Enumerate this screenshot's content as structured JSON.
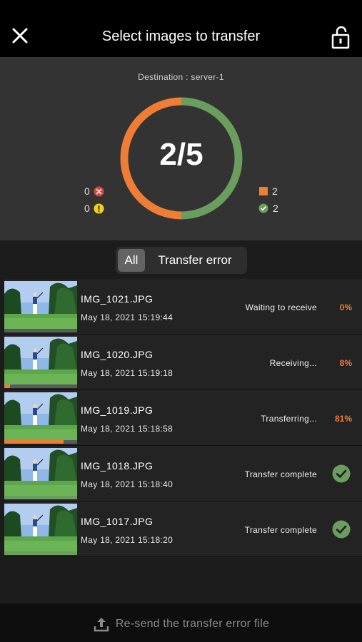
{
  "header": {
    "title": "Select images to transfer",
    "close_icon": "close-icon",
    "lock_icon": "unlock-icon"
  },
  "summary": {
    "destination": "Destination : server-1",
    "count_text": "2/5",
    "progress": {
      "pending_fraction": 0.5,
      "complete_fraction": 0.5
    },
    "left_stats": {
      "error_count": "0",
      "warning_count": "0"
    },
    "right_stats": {
      "in_progress_count": "2",
      "complete_count": "2"
    },
    "colors": {
      "pending": "#ef7d36",
      "complete": "#6a9d5e",
      "track": "#262626",
      "error": "#e0443d",
      "warning": "#f2d21a"
    }
  },
  "filters": {
    "all_label": "All",
    "error_label": "Transfer error",
    "selected": "All"
  },
  "items": [
    {
      "name": "IMG_1021.JPG",
      "date": "May 18, 2021 15:19:44",
      "status": "Waiting to receive",
      "percent": "0%",
      "progress": 0.0,
      "bar_color": "#ef7d36",
      "complete": false
    },
    {
      "name": "IMG_1020.JPG",
      "date": "May 18, 2021 15:19:18",
      "status": "Receiving...",
      "percent": "8%",
      "progress": 0.08,
      "bar_color": "#ef7d36",
      "complete": false
    },
    {
      "name": "IMG_1019.JPG",
      "date": "May 18, 2021 15:18:58",
      "status": "Transferring...",
      "percent": "81%",
      "progress": 0.81,
      "bar_color": "#ef7d36",
      "complete": false
    },
    {
      "name": "IMG_1018.JPG",
      "date": "May 18, 2021 15:18:40",
      "status": "Transfer complete",
      "percent": "",
      "progress": 1.0,
      "bar_color": "#6a9d5e",
      "complete": true
    },
    {
      "name": "IMG_1017.JPG",
      "date": "May 18, 2021 15:18:20",
      "status": "Transfer complete",
      "percent": "",
      "progress": 1.0,
      "bar_color": "#6a9d5e",
      "complete": true
    }
  ],
  "footer": {
    "resend_label": "Re-send the transfer error file",
    "upload_icon": "upload-icon"
  }
}
